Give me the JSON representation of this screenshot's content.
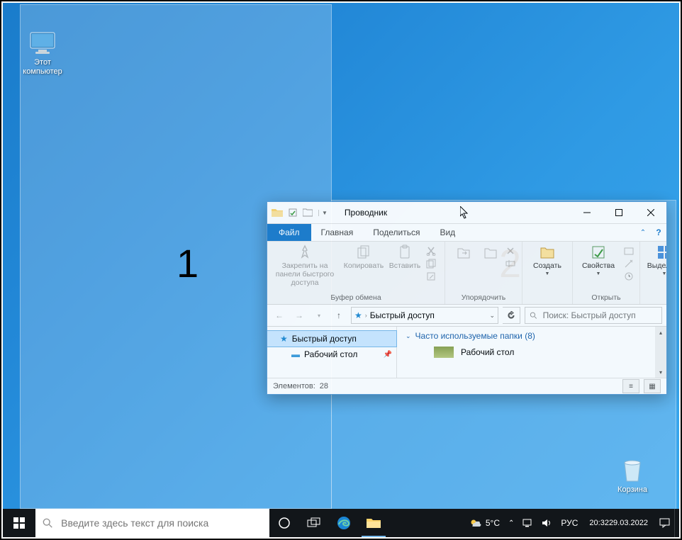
{
  "desktop": {
    "icons": {
      "this_pc": "Этот компьютер",
      "recycle_bin": "Корзина"
    }
  },
  "snap": {
    "zone1": "1",
    "zone2": "2"
  },
  "taskbar": {
    "search_placeholder": "Введите здесь текст для поиска",
    "weather_temp": "5°C",
    "language": "РУС",
    "time": "20:32",
    "date": "29.03.2022"
  },
  "explorer": {
    "title": "Проводник",
    "tabs": {
      "file": "Файл",
      "home": "Главная",
      "share": "Поделиться",
      "view": "Вид"
    },
    "ribbon": {
      "pin": "Закрепить на панели быстрого доступа",
      "copy": "Копировать",
      "paste": "Вставить",
      "clipboard_group": "Буфер обмена",
      "organize_group": "Упорядочить",
      "new_group": "Создать",
      "properties": "Свойства",
      "open_group": "Открыть",
      "select_group": "Выделить"
    },
    "address": {
      "location": "Быстрый доступ"
    },
    "search_placeholder": "Поиск: Быстрый доступ",
    "nav": {
      "quick_access": "Быстрый доступ",
      "desktop": "Рабочий стол"
    },
    "content": {
      "section_title": "Часто используемые папки (8)",
      "folder_desktop": "Рабочий стол"
    },
    "status": {
      "items_label": "Элементов:",
      "items_count": "28"
    }
  }
}
